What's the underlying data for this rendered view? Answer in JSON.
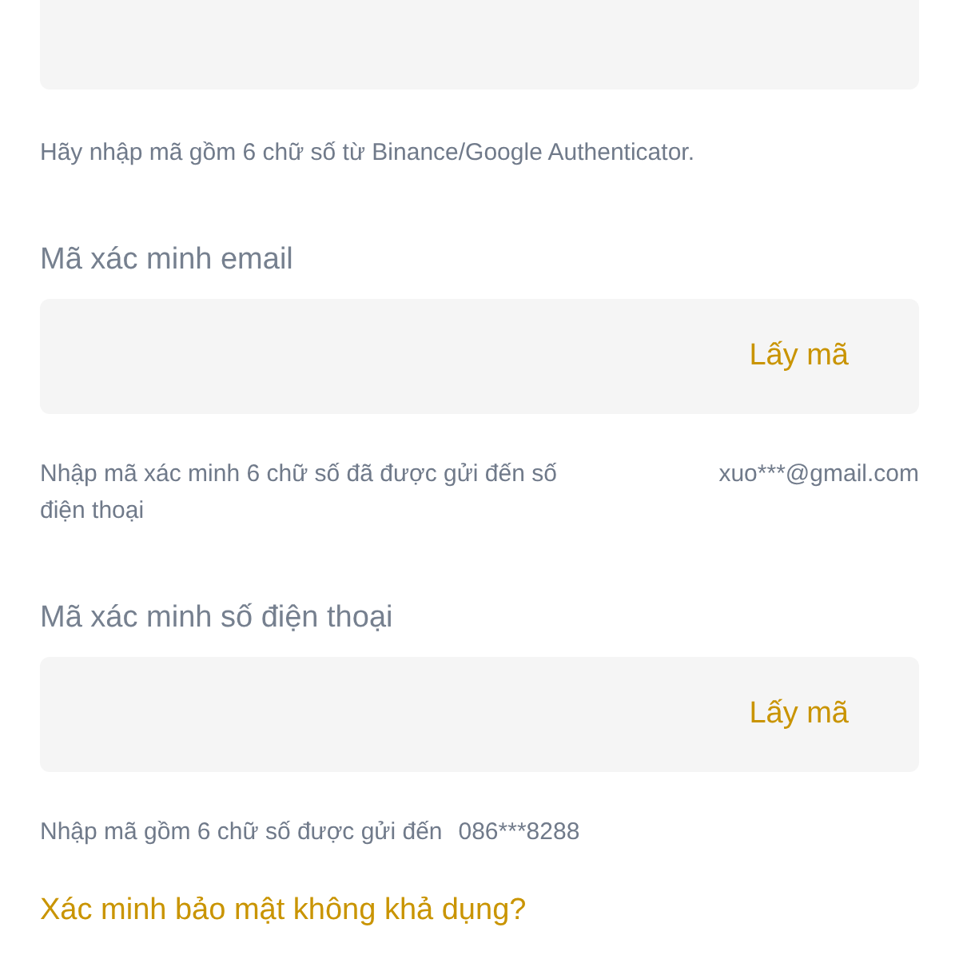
{
  "fields": [
    {
      "kind": "authenticator",
      "hint": "Hãy nhập mã gồm 6 chữ số từ Binance/Google Authenticator."
    },
    {
      "kind": "email",
      "label": "Mã xác minh email",
      "action": "Lấy mã",
      "hint": "Nhập mã xác minh 6 chữ số đã được gửi đến số điện thoại",
      "recipient": "xuo***@gmail.com"
    },
    {
      "kind": "phone",
      "label": "Mã xác minh số điện thoại",
      "action": "Lấy mã",
      "hint": "Nhập mã gồm 6 chữ số được gửi đến",
      "recipient": "086***8288"
    }
  ],
  "link": "Xác minh bảo mật không khả dụng?"
}
